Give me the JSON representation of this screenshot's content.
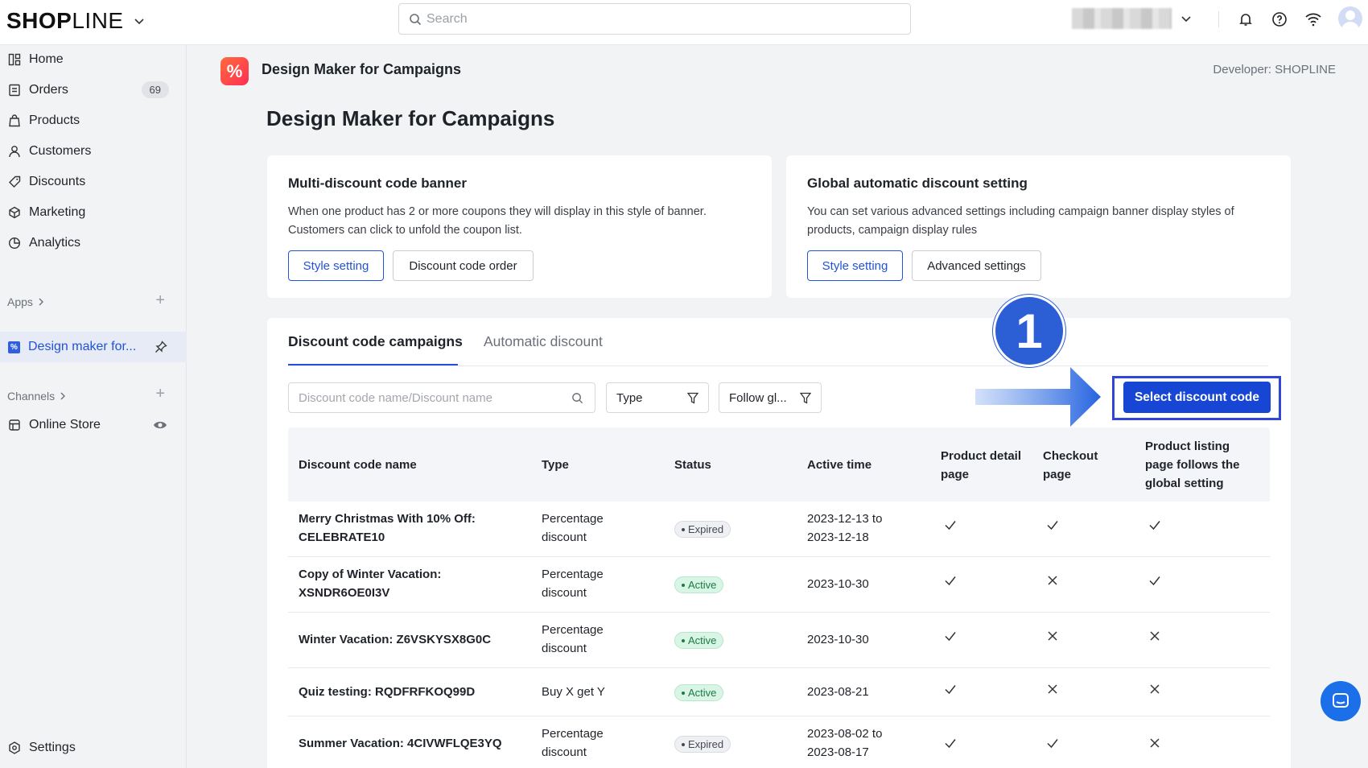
{
  "topbar": {
    "logo_bold": "SHOP",
    "logo_light": "LINE",
    "search_placeholder": "Search"
  },
  "sidebar": {
    "items": [
      {
        "label": "Home",
        "icon": "home-icon"
      },
      {
        "label": "Orders",
        "icon": "orders-icon",
        "badge": "69"
      },
      {
        "label": "Products",
        "icon": "products-icon"
      },
      {
        "label": "Customers",
        "icon": "customers-icon"
      },
      {
        "label": "Discounts",
        "icon": "discounts-icon"
      },
      {
        "label": "Marketing",
        "icon": "marketing-icon"
      },
      {
        "label": "Analytics",
        "icon": "analytics-icon"
      }
    ],
    "apps_label": "Apps",
    "app_item": "Design maker for...",
    "channels_label": "Channels",
    "online_store": "Online Store",
    "settings": "Settings"
  },
  "app_header": {
    "name": "Design Maker for Campaigns",
    "logo_glyph": "%",
    "developer": "Developer: SHOPLINE"
  },
  "page": {
    "title": "Design Maker for Campaigns"
  },
  "cards": {
    "multi": {
      "title": "Multi-discount code banner",
      "desc_line1": "When one product has 2 or more coupons they will display in this style of banner.",
      "desc_line2": "Customers can click to unfold the coupon list.",
      "btn_style": "Style setting",
      "btn_order": "Discount code order"
    },
    "global": {
      "title": "Global automatic discount setting",
      "desc_line1": "You can set various advanced settings including campaign banner display styles of",
      "desc_line2": "products, campaign display rules",
      "btn_style": "Style setting",
      "btn_advanced": "Advanced settings"
    }
  },
  "tabs": {
    "active": "Discount code campaigns",
    "inactive": "Automatic discount"
  },
  "filters": {
    "search_placeholder": "Discount code name/Discount name",
    "type": "Type",
    "follow": "Follow gl..."
  },
  "annotation": {
    "step": "1"
  },
  "primary_button": "Select discount code",
  "table": {
    "headers": {
      "name": "Discount code name",
      "type": "Type",
      "status": "Status",
      "active_time": "Active time",
      "pdp_1": "Product detail",
      "pdp_2": "page",
      "checkout_1": "Checkout",
      "checkout_2": "page",
      "plp_1": "Product listing",
      "plp_2": "page follows the",
      "plp_3": "global setting"
    },
    "rows": [
      {
        "name1": "Merry Christmas With 10% Off:",
        "name2": "CELEBRATE10",
        "type1": "Percentage",
        "type2": "discount",
        "status": "Expired",
        "time1": "2023-12-13 to",
        "time2": "2023-12-18",
        "pdp": true,
        "checkout": true,
        "plp": true
      },
      {
        "name1": "Copy of Winter Vacation:",
        "name2": "XSNDR6OE0I3V",
        "type1": "Percentage",
        "type2": "discount",
        "status": "Active",
        "time1": "2023-10-30",
        "time2": "",
        "pdp": true,
        "checkout": false,
        "plp": true
      },
      {
        "name1": "Winter Vacation: Z6VSKYSX8G0C",
        "name2": "",
        "type1": "Percentage",
        "type2": "discount",
        "status": "Active",
        "time1": "2023-10-30",
        "time2": "",
        "pdp": true,
        "checkout": false,
        "plp": false
      },
      {
        "name1": "Quiz testing: RQDFRFKOQ99D",
        "name2": "",
        "type1": "Buy X get Y",
        "type2": "",
        "status": "Active",
        "time1": "2023-08-21",
        "time2": "",
        "pdp": true,
        "checkout": false,
        "plp": false
      },
      {
        "name1": "Summer Vacation: 4CIVWFLQE3YQ",
        "name2": "",
        "type1": "Percentage",
        "type2": "discount",
        "status": "Expired",
        "time1": "2023-08-02 to",
        "time2": "2023-08-17",
        "pdp": true,
        "checkout": true,
        "plp": false
      }
    ]
  }
}
